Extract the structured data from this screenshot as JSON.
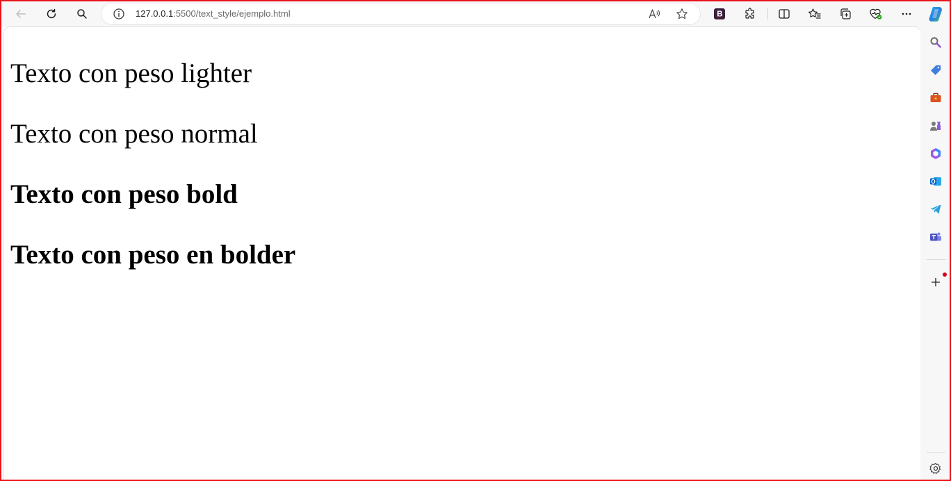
{
  "browser": {
    "url_host": "127.0.0.1",
    "url_rest": ":5500/text_style/ejemplo.html"
  },
  "page": {
    "paragraphs": [
      {
        "text": "Texto con peso lighter"
      },
      {
        "text": "Texto con peso normal"
      },
      {
        "text": "Texto con peso bold"
      },
      {
        "text": "Texto con peso en bolder"
      }
    ]
  },
  "toolbar_icons": [
    "back-icon",
    "refresh-icon",
    "search-icon",
    "info-icon",
    "read-aloud-icon",
    "favorite-star-icon",
    "bootstrap-extension-icon",
    "extensions-icon",
    "split-screen-icon",
    "favorites-icon",
    "collections-icon",
    "browser-essentials-icon",
    "more-icon",
    "copilot-icon"
  ],
  "sidebar_icons": [
    "search-icon",
    "shopping-tag-icon",
    "tools-icon",
    "games-icon",
    "office-icon",
    "outlook-icon",
    "telegram-icon",
    "teams-icon",
    "add-icon",
    "settings-icon"
  ],
  "colors": {
    "frame": "#e8141a",
    "toolbar_bg": "#f7f7f7",
    "text": "#000000"
  }
}
